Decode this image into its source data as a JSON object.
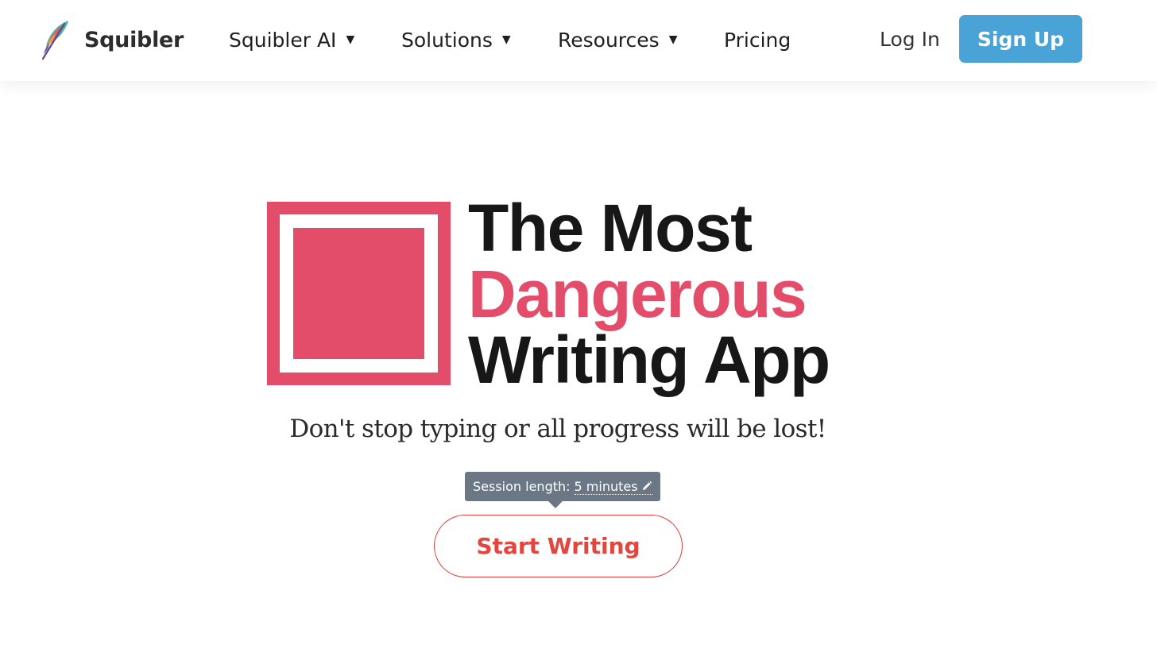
{
  "header": {
    "brand": {
      "name": "Squibler",
      "icon": "feather-quill-icon"
    },
    "nav": [
      {
        "label": "Squibler AI",
        "has_dropdown": true
      },
      {
        "label": "Solutions",
        "has_dropdown": true
      },
      {
        "label": "Resources",
        "has_dropdown": true
      },
      {
        "label": "Pricing",
        "has_dropdown": false
      }
    ],
    "login_label": "Log In",
    "signup_label": "Sign Up"
  },
  "hero": {
    "logo_icon": "nested-square-logo",
    "title_line1": "The Most",
    "title_line2": "Dangerous",
    "title_line3": "Writing App",
    "subtitle": "Don't stop typing or all progress will be lost!",
    "session": {
      "label": "Session length:",
      "value": "5 minutes",
      "edit_icon": "pencil-icon"
    },
    "cta_label": "Start Writing"
  },
  "colors": {
    "accent": "#e44d6a",
    "signup_bg": "#4aa3d6",
    "cta_text": "#e2473f",
    "tooltip_bg": "#6b7785",
    "title_text": "#171717"
  }
}
